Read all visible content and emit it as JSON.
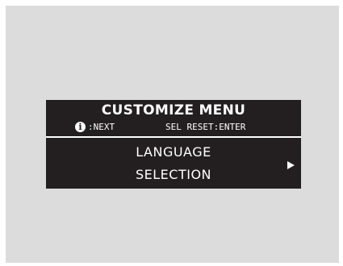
{
  "menu": {
    "title": "CUSTOMIZE MENU",
    "hint_next": ":NEXT",
    "hint_sel_reset": "SEL RESET:ENTER",
    "info_icon_glyph": "i",
    "item_line1": "LANGUAGE",
    "item_line2": "SELECTION",
    "next_arrow_icon": "right-triangle-icon"
  },
  "colors": {
    "screen_bg": "#231f20",
    "text": "#ffffff",
    "frame_bg": "#dcdcdc"
  }
}
